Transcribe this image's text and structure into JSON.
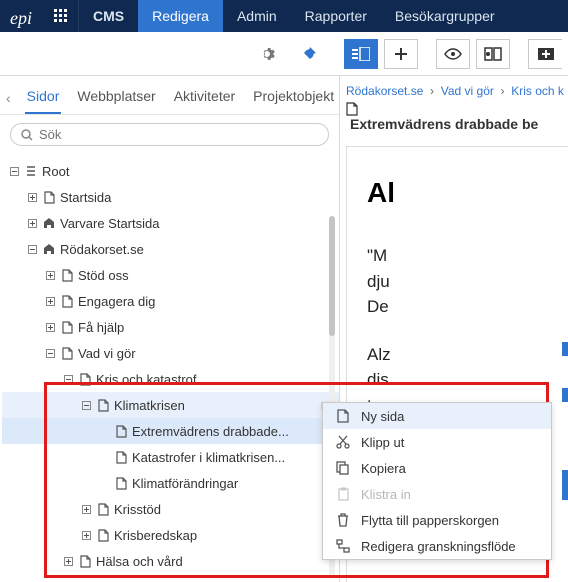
{
  "topbar": {
    "brand": "epi",
    "cms": "CMS",
    "items": [
      "Redigera",
      "Admin",
      "Rapporter",
      "Besökargrupper"
    ],
    "active_index": 0
  },
  "left": {
    "tabs": [
      "Sidor",
      "Webbplatser",
      "Aktiviteter",
      "Projektobjekt"
    ],
    "active_tab": 0,
    "search_placeholder": "Sök",
    "tree": [
      {
        "depth": 0,
        "toggle": "minus",
        "icon": "list",
        "label": "Root"
      },
      {
        "depth": 1,
        "toggle": "plus",
        "icon": "page",
        "label": "Startsida"
      },
      {
        "depth": 1,
        "toggle": "plus",
        "icon": "home",
        "label": "Varvare Startsida"
      },
      {
        "depth": 1,
        "toggle": "minus",
        "icon": "home",
        "label": "Rödakorset.se"
      },
      {
        "depth": 2,
        "toggle": "plus",
        "icon": "page",
        "label": "Stöd oss"
      },
      {
        "depth": 2,
        "toggle": "plus",
        "icon": "page",
        "label": "Engagera dig"
      },
      {
        "depth": 2,
        "toggle": "plus",
        "icon": "page",
        "label": "Få hjälp"
      },
      {
        "depth": 2,
        "toggle": "minus",
        "icon": "page",
        "label": "Vad vi gör"
      },
      {
        "depth": 3,
        "toggle": "minus",
        "icon": "page",
        "label": "Kris och katastrof"
      },
      {
        "depth": 4,
        "toggle": "minus",
        "icon": "page",
        "label": "Klimatkrisen",
        "selected": true,
        "menu": true
      },
      {
        "depth": 5,
        "toggle": "none",
        "icon": "page",
        "label": "Extremvädrens drabbade...",
        "highlight": true
      },
      {
        "depth": 5,
        "toggle": "none",
        "icon": "page",
        "label": "Katastrofer i klimatkrisen..."
      },
      {
        "depth": 5,
        "toggle": "none",
        "icon": "page",
        "label": "Klimatförändringar"
      },
      {
        "depth": 4,
        "toggle": "plus",
        "icon": "page",
        "label": "Krisstöd"
      },
      {
        "depth": 4,
        "toggle": "plus",
        "icon": "page",
        "label": "Krisberedskap"
      },
      {
        "depth": 3,
        "toggle": "plus",
        "icon": "page",
        "label": "Hälsa och vård"
      }
    ]
  },
  "right": {
    "breadcrumb": [
      "Rödakorset.se",
      "Vad vi gör",
      "Kris och k"
    ],
    "doc_title": "Extremvädrens drabbade be",
    "preview_h1": "Al",
    "preview_p1": "\"M\ndju\nDe",
    "preview_p2": "Alz\ndis\nta"
  },
  "context_menu": {
    "items": [
      {
        "icon": "page",
        "label": "Ny sida",
        "highlight": true
      },
      {
        "icon": "cut",
        "label": "Klipp ut"
      },
      {
        "icon": "copy",
        "label": "Kopiera"
      },
      {
        "icon": "paste",
        "label": "Klistra in",
        "disabled": true
      },
      {
        "icon": "trash",
        "label": "Flytta till papperskorgen"
      },
      {
        "icon": "flow",
        "label": "Redigera granskningsflöde"
      }
    ]
  }
}
